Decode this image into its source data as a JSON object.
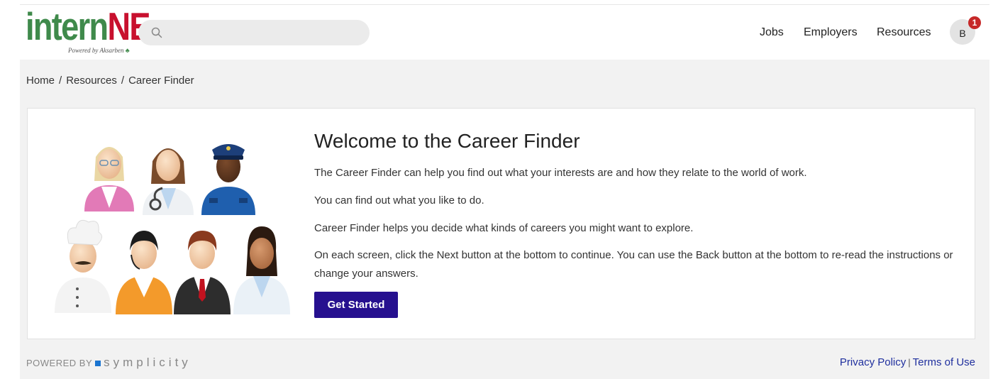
{
  "header": {
    "logo_main_left": "intern",
    "logo_main_right": "NE",
    "logo_tagline": "Powered by Aksarben",
    "search": {
      "placeholder": "",
      "value": "",
      "icon": "search-icon"
    },
    "nav": [
      "Jobs",
      "Employers",
      "Resources"
    ],
    "user": {
      "initial": "B",
      "notification_count": "1"
    }
  },
  "breadcrumb": {
    "home": "Home",
    "resources": "Resources",
    "current": "Career Finder"
  },
  "main": {
    "title": "Welcome to the Career Finder",
    "paragraphs": [
      "The Career Finder can help you find out what your interests are and how they relate to the world of work.",
      "You can find out what you like to do.",
      "Career Finder helps you decide what kinds of careers you might want to explore.",
      "On each screen, click the Next button at the bottom to continue. You can use the Back button at the bottom to re-read the instructions or change your answers."
    ],
    "button_label": "Get Started",
    "illustration": "careers-people-illustration"
  },
  "footer": {
    "powered_by": "POWERED BY",
    "brand": "symplicity",
    "privacy": "Privacy Policy",
    "separator": "|",
    "terms": "Terms of Use"
  },
  "colors": {
    "logo_green": "#3f8a4b",
    "logo_red": "#c8102e",
    "primary_button": "#26108f",
    "link": "#1f2f9e",
    "badge": "#c62828"
  }
}
